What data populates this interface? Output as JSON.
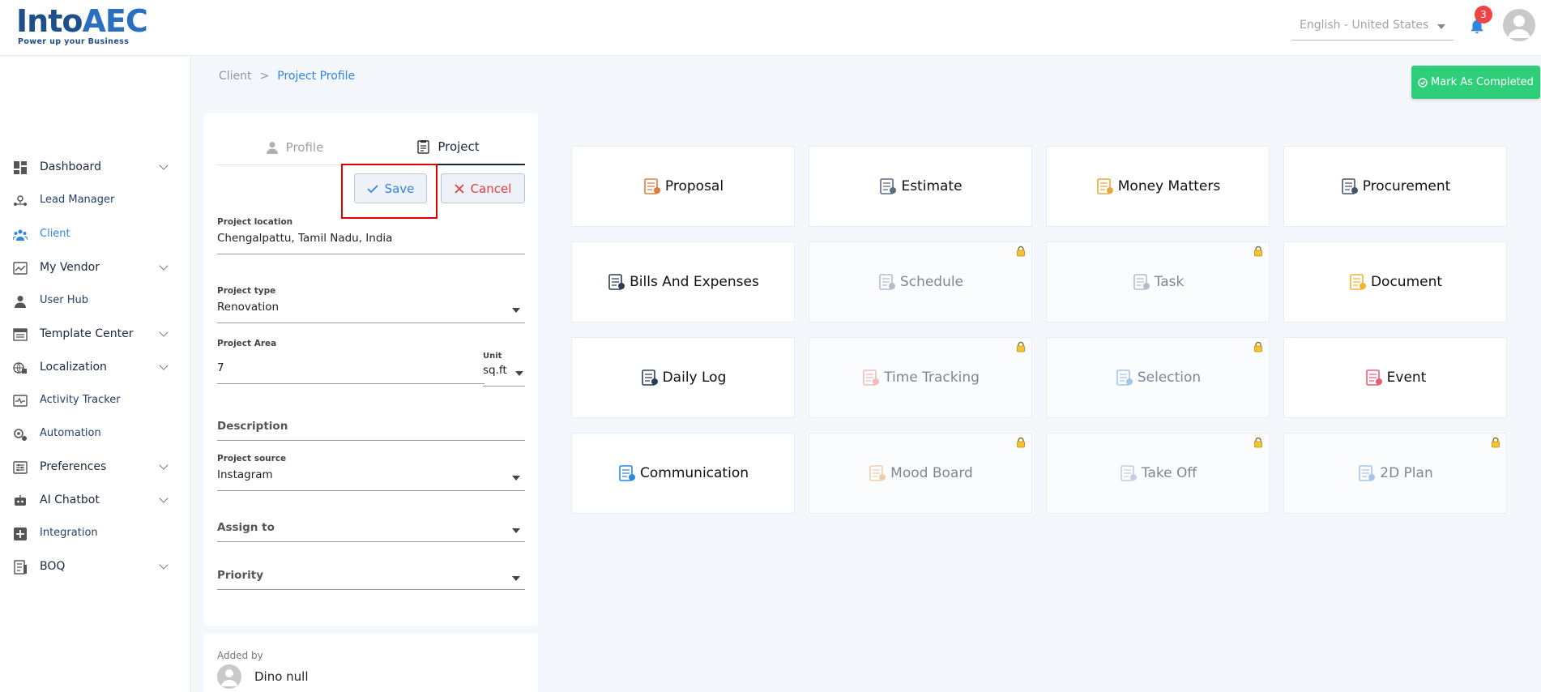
{
  "header": {
    "logo_title_a": "Into",
    "logo_title_b": "AEC",
    "logo_tagline": "Power up your Business",
    "language": "English - United States",
    "notification_count": "3"
  },
  "sidebar": {
    "items": [
      {
        "label": "Dashboard",
        "icon": "dashboard-icon",
        "chevron": true
      },
      {
        "label": "Lead Manager",
        "icon": "lead-manager-icon",
        "chevron": false
      },
      {
        "label": "Client",
        "icon": "client-icon",
        "chevron": false
      },
      {
        "label": "My Vendor",
        "icon": "vendor-icon",
        "chevron": true
      },
      {
        "label": "User Hub",
        "icon": "user-icon",
        "chevron": false
      },
      {
        "label": "Template Center",
        "icon": "template-icon",
        "chevron": true
      },
      {
        "label": "Localization",
        "icon": "localization-icon",
        "chevron": true
      },
      {
        "label": "Activity Tracker",
        "icon": "activity-icon",
        "chevron": false
      },
      {
        "label": "Automation",
        "icon": "automation-icon",
        "chevron": false
      },
      {
        "label": "Preferences",
        "icon": "preferences-icon",
        "chevron": true
      },
      {
        "label": "AI Chatbot",
        "icon": "chatbot-icon",
        "chevron": true
      },
      {
        "label": "Integration",
        "icon": "integration-icon",
        "chevron": false
      },
      {
        "label": "BOQ",
        "icon": "boq-icon",
        "chevron": true
      }
    ]
  },
  "breadcrumb": {
    "parent": "Client",
    "separator": ">",
    "current": "Project Profile"
  },
  "actions": {
    "mark_completed": "Mark As Completed",
    "save": "Save",
    "cancel": "Cancel"
  },
  "tabs": {
    "profile": "Profile",
    "project": "Project"
  },
  "form": {
    "location_label": "Project location",
    "location_value": "Chengalpattu, Tamil Nadu, India",
    "type_label": "Project type",
    "type_value": "Renovation",
    "area_label": "Project Area",
    "area_value": "7",
    "unit_label": "Unit",
    "unit_value": "sq.ft",
    "description_label": "Description",
    "source_label": "Project source",
    "source_value": "Instagram",
    "assign_label": "Assign to",
    "priority_label": "Priority"
  },
  "added_by": {
    "label": "Added by",
    "name": "Dino null"
  },
  "modules": [
    {
      "label": "Proposal",
      "locked": false,
      "icon": "proposal-icon"
    },
    {
      "label": "Estimate",
      "locked": false,
      "icon": "estimate-icon"
    },
    {
      "label": "Money Matters",
      "locked": false,
      "icon": "money-matters-icon"
    },
    {
      "label": "Procurement",
      "locked": false,
      "icon": "procurement-icon"
    },
    {
      "label": "Bills And Expenses",
      "locked": false,
      "icon": "bills-icon"
    },
    {
      "label": "Schedule",
      "locked": true,
      "icon": "schedule-icon"
    },
    {
      "label": "Task",
      "locked": true,
      "icon": "task-icon"
    },
    {
      "label": "Document",
      "locked": false,
      "icon": "document-icon"
    },
    {
      "label": "Daily Log",
      "locked": false,
      "icon": "daily-log-icon"
    },
    {
      "label": "Time Tracking",
      "locked": true,
      "icon": "time-tracking-icon"
    },
    {
      "label": "Selection",
      "locked": true,
      "icon": "selection-icon"
    },
    {
      "label": "Event",
      "locked": false,
      "icon": "event-icon"
    },
    {
      "label": "Communication",
      "locked": false,
      "icon": "communication-icon"
    },
    {
      "label": "Mood Board",
      "locked": true,
      "icon": "mood-board-icon"
    },
    {
      "label": "Take Off",
      "locked": true,
      "icon": "take-off-icon"
    },
    {
      "label": "2D Plan",
      "locked": true,
      "icon": "2d-plan-icon"
    }
  ],
  "colors": {
    "accent": "#2e86de",
    "success": "#2fcf7a",
    "danger": "#e53e3e",
    "highlight": "#e00000"
  }
}
